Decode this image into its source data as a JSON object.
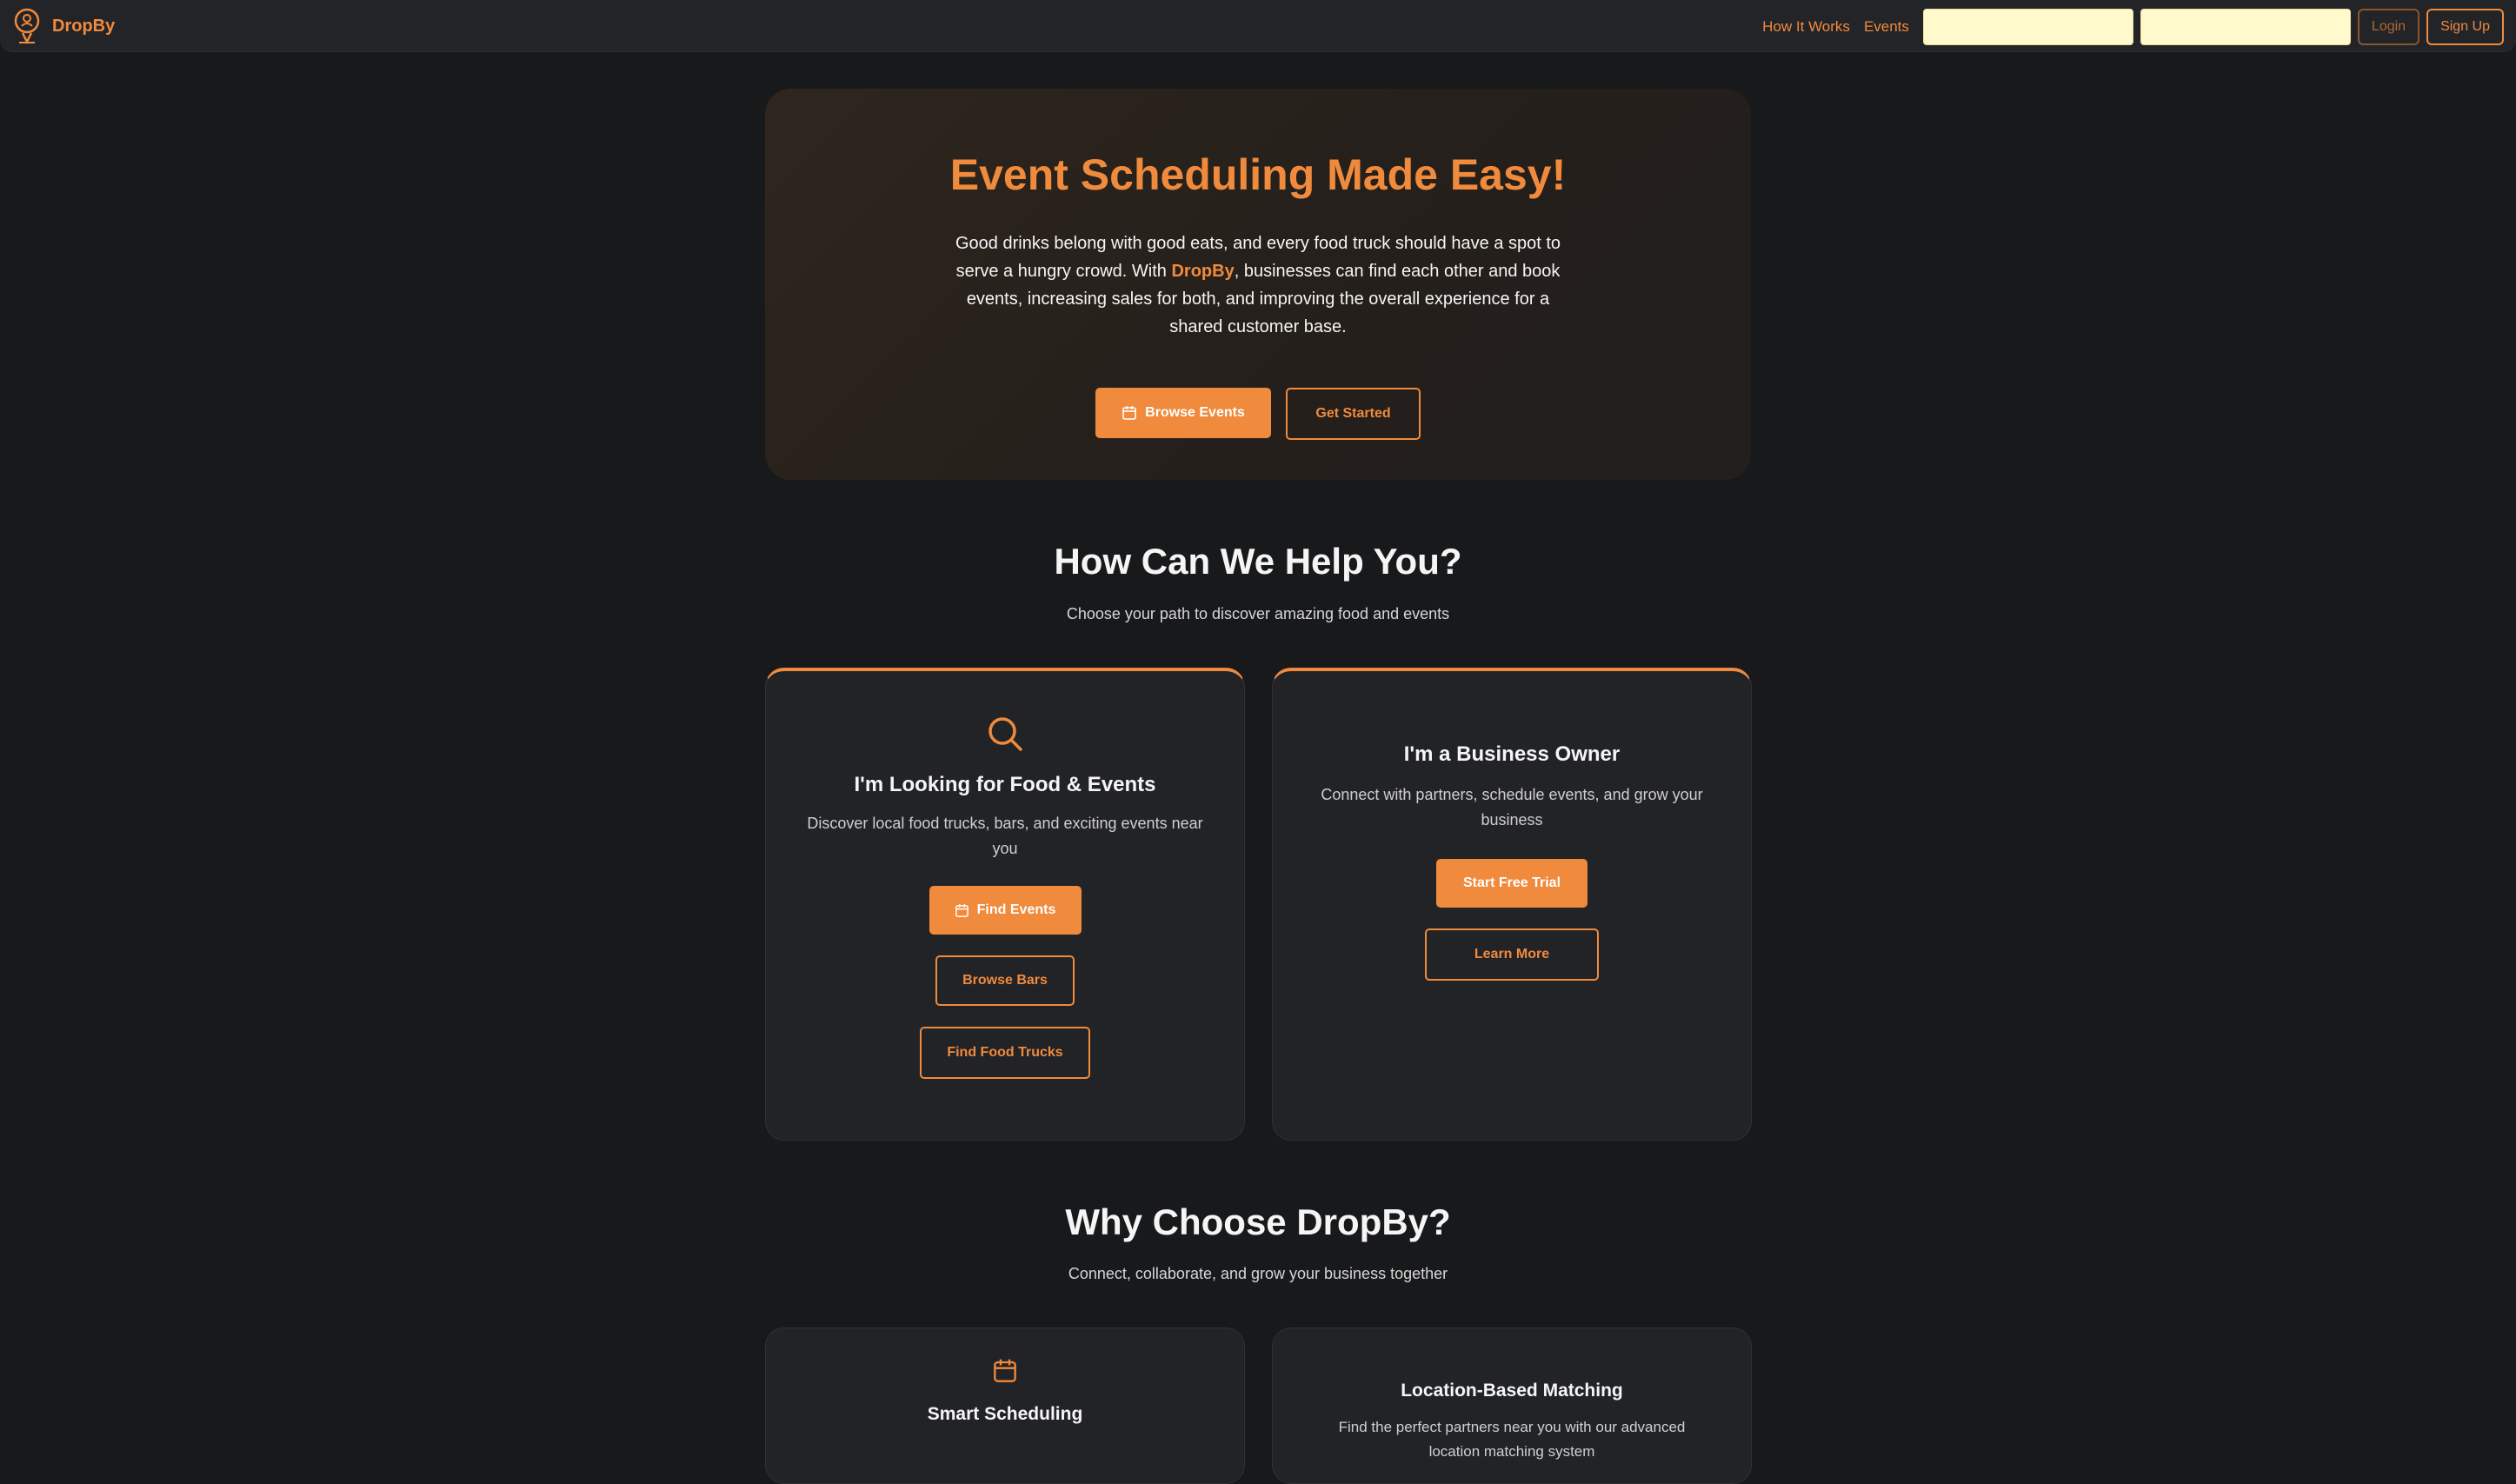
{
  "nav": {
    "brand": "DropBy",
    "links": [
      "How It Works",
      "Events"
    ],
    "login_label": "Login",
    "signup_label": "Sign Up"
  },
  "hero": {
    "title": "Event Scheduling Made Easy!",
    "text_before": "Good drinks belong with good eats, and every food truck should have a spot to serve a hungry crowd. With ",
    "brand": "DropBy",
    "text_after": ", businesses can find each other and book events, increasing sales for both, and improving the overall experience for a shared customer base.",
    "browse_events_label": "Browse Events",
    "get_started_label": "Get Started"
  },
  "help": {
    "title": "How Can We Help You?",
    "subtitle": "Choose your path to discover amazing food and events",
    "consumer_card": {
      "icon": "search-icon",
      "title": "I'm Looking for Food & Events",
      "text": "Discover local food trucks, bars, and exciting events near you",
      "find_events_label": "Find Events",
      "browse_bars_label": "Browse Bars",
      "find_food_trucks_label": "Find Food Trucks"
    },
    "business_card": {
      "title": "I'm a Business Owner",
      "text": "Connect with partners, schedule events, and grow your business",
      "start_trial_label": "Start Free Trial",
      "learn_more_label": "Learn More"
    }
  },
  "why": {
    "title": "Why Choose DropBy?",
    "subtitle": "Connect, collaborate, and grow your business together",
    "features": [
      {
        "icon": "calendar-icon",
        "title": "Smart Scheduling"
      },
      {
        "title": "Location-Based Matching",
        "text": "Find the perfect partners near you with our advanced location matching system"
      }
    ]
  },
  "colors": {
    "accent": "#f08a3c",
    "background": "#18191b",
    "card": "#222327",
    "input": "#fff9cc"
  }
}
